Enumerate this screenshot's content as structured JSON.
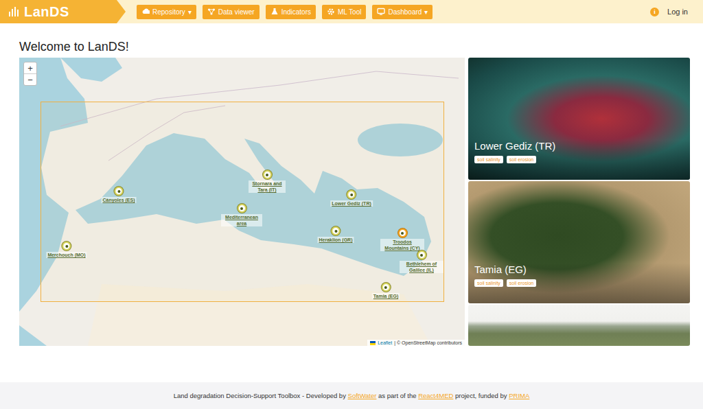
{
  "nav": {
    "logo": "LanDS",
    "items": [
      {
        "label": "Repository",
        "caret": "▾"
      },
      {
        "label": "Data viewer",
        "caret": ""
      },
      {
        "label": "Indicators",
        "caret": ""
      },
      {
        "label": "ML Tool",
        "caret": ""
      },
      {
        "label": "Dashboard",
        "caret": "▾"
      }
    ],
    "info": "i",
    "login": "Log in"
  },
  "title": "Welcome to LanDS!",
  "map": {
    "zoom_in": "+",
    "zoom_out": "−",
    "attribution": {
      "leaflet": "Leaflet",
      "rest": "| © OpenStreetMap contributors"
    },
    "markers": [
      {
        "label": "Cànyoles (ES)",
        "selected": false
      },
      {
        "label": "Stornara and Tara (IT)",
        "selected": false
      },
      {
        "label": "Mediterranean area",
        "selected": false
      },
      {
        "label": "Lower Gediz (TR)",
        "selected": false
      },
      {
        "label": "Heraklion (GR)",
        "selected": false
      },
      {
        "label": "Troodos Mountains (CY)",
        "selected": true
      },
      {
        "label": "Bethlehem of Galilee (IL)",
        "selected": false
      },
      {
        "label": "Merchouch (MO)",
        "selected": false
      },
      {
        "label": "Tamia (EG)",
        "selected": false
      }
    ]
  },
  "cards": [
    {
      "title": "Lower Gediz (TR)",
      "tags": [
        "soil salinity",
        "soil erosion"
      ]
    },
    {
      "title": "Tamia (EG)",
      "tags": [
        "soil salinity",
        "soil erosion"
      ]
    }
  ],
  "footer": [
    {
      "text": "Land degradation Decision-Support Toolbox - Developed by ",
      "kind": "text"
    },
    {
      "text": "SoftWater",
      "kind": "link"
    },
    {
      "text": " as part of the ",
      "kind": "text"
    },
    {
      "text": "React4MED",
      "kind": "link"
    },
    {
      "text": " project, funded by ",
      "kind": "text"
    },
    {
      "text": "PRIMA",
      "kind": "link"
    }
  ]
}
